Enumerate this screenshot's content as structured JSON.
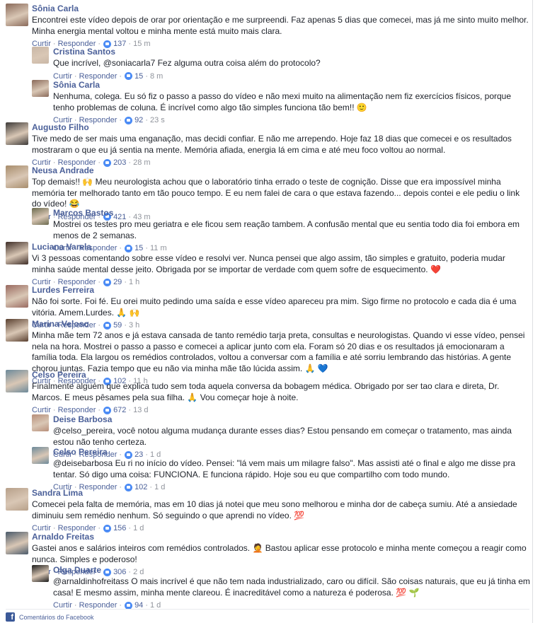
{
  "feed": {
    "footer_label": "Comentários do Facebook",
    "comments": [
      {
        "author": "Sônia Carla",
        "text": "Encontrei este vídeo depois de orar por orientação e me surpreendi. Faz apenas 5 dias que comecei, mas já me sinto muito melhor. Minha energia mental voltou e minha mente está muito mais clara.",
        "likes": "137",
        "time": "15 m",
        "reply": false,
        "avatar": "#8a6a5a"
      },
      {
        "author": "Cristina Santos",
        "text": "Que incrível, @soniacarla7 Fez alguma outra coisa além do protocolo?",
        "likes": "15",
        "time": "8 m",
        "reply": true,
        "avatar": "#c9b7a6"
      },
      {
        "author": "Sônia Carla",
        "text": "Nenhuma, colega. Eu só fiz o passo a passo do vídeo e não mexi muito na alimentação nem fiz exercícios físicos, porque tenho problemas de coluna. É incrível como algo tão simples funciona tão bem!! 🙂",
        "likes": "92",
        "time": "23 s",
        "reply": true,
        "avatar": "#8a6a5a"
      },
      {
        "author": "Augusto Filho",
        "text": "Tive medo de ser mais uma enganação, mas decidi confiar. E não me arrependo. Hoje faz 18 dias que comecei e os resultados mostraram o que eu já sentia na mente. Memória afiada, energia lá em cima e até meu foco voltou ao normal.",
        "likes": "203",
        "time": "28 m",
        "reply": false,
        "avatar": "#3d3a38"
      },
      {
        "author": "Neusa Andrade",
        "text": "Top demais!! 🙌 Meu neurologista achou que o laboratório tinha errado o teste de cognição. Disse que era impossível minha memória ter melhorado tanto em tão pouco tempo. E eu nem falei de cara o que estava fazendo... depois contei e ele pediu o link do vídeo! 😂",
        "likes": "421",
        "time": "43 m",
        "reply": false,
        "avatar": "#a88d6c"
      },
      {
        "author": "Marcos Bastos",
        "text": "Mostrei os testes pro meu geriatra e ele ficou sem reação tambem. A confusão mental que eu sentia todo dia foi embora em menos de 2 semanas.",
        "likes": "15",
        "time": "11 m",
        "reply": true,
        "avatar": "#6b6a4e"
      },
      {
        "author": "Luciana Varela",
        "text": "Vi 3 pessoas comentando sobre esse vídeo e resolvi ver. Nunca pensei que algo assim, tão simples e gratuito, poderia mudar minha saúde mental desse jeito. Obrigada por se importar de verdade com quem sofre de esquecimento. ❤️",
        "likes": "29",
        "time": "1 h",
        "reply": false,
        "avatar": "#3f2e28"
      },
      {
        "author": "Lurdes Ferreira",
        "text": "Não foi sorte. Foi fé. Eu orei muito pedindo uma saída e esse vídeo apareceu pra mim. Sigo firme no protocolo e cada dia é uma vitória. Amem.Lurdes. 🙏 🙌",
        "likes": "59",
        "time": "3 h",
        "reply": false,
        "avatar": "#9a6a60"
      },
      {
        "author": "Marina Veloso",
        "text": "Minha mãe tem 72 anos e já estava cansada de tanto remédio tarja preta, consultas e neurologistas. Quando vi esse vídeo, pensei nela na hora. Mostrei o passo a passo e comecei a aplicar junto com ela. Foram só 20 dias e os resultados já emocionaram a família toda. Ela largou os remédios controlados, voltou a conversar com a família e até sorriu lembrando das histórias. A gente chorou juntas. Fazia tempo que eu não via minha mãe tão lúcida assim. 🙏 💙",
        "likes": "102",
        "time": "11 h",
        "reply": false,
        "avatar": "#5a4030"
      },
      {
        "author": "Celso Pereira",
        "text": "Finalmente alguém que explica tudo sem toda aquela conversa da bobagem médica. Obrigado por ser tao clara e direta, Dr. Marcos. E meus pêsames pela sua filha. 🙏 Vou começar hoje à noite.",
        "likes": "672",
        "time": "13 d",
        "reply": false,
        "avatar": "#6d8a9a"
      },
      {
        "author": "Deise Barbosa",
        "text": "@celso_pereira, você notou alguma mudança durante esses dias? Estou pensando em começar o tratamento, mas ainda estou não tenho certeza.",
        "likes": "23",
        "time": "1 d",
        "reply": true,
        "avatar": "#b88f7a"
      },
      {
        "author": "Celso Pereira",
        "text": "@deisebarbosa Eu ri no início do vídeo. Pensei: \"lá vem mais um milagre falso\". Mas assisti até o final e algo me disse pra tentar. Só digo uma coisa: FUNCIONA. E funciona rápido. Hoje sou eu que compartilho com todo mundo.",
        "likes": "102",
        "time": "1 d",
        "reply": true,
        "avatar": "#6d8a9a"
      },
      {
        "author": "Sandra Lima",
        "text": "Comecei pela falta de memória, mas em 10 dias já notei que meu sono melhorou e minha dor de cabeça sumiu. Até a ansiedade diminuiu sem remédio nenhum. Só seguindo o que aprendi no vídeo. 💯",
        "likes": "156",
        "time": "1 d",
        "reply": false,
        "avatar": "#b7a08a"
      },
      {
        "author": "Arnaldo Freitas",
        "text": "Gastei anos e salários inteiros com remédios controlados. 🤦 Bastou aplicar esse protocolo e minha mente começou a reagir como nunca. Simples e poderoso!",
        "likes": "306",
        "time": "2 d",
        "reply": false,
        "avatar": "#4a5a6a"
      },
      {
        "author": "Olga Duarte",
        "text": "@arnaldinhofreitass O mais incrível é que não tem nada industrializado, caro ou difícil. São coisas naturais, que eu já tinha em casa! E mesmo assim, minha mente clareou. É inacreditável como a natureza é poderosa. 💯 🌱",
        "likes": "94",
        "time": "1 d",
        "reply": true,
        "avatar": "#1b1b1b"
      }
    ],
    "actions": {
      "like": "Curtir",
      "reply": "Responder",
      "dot": "·"
    }
  }
}
